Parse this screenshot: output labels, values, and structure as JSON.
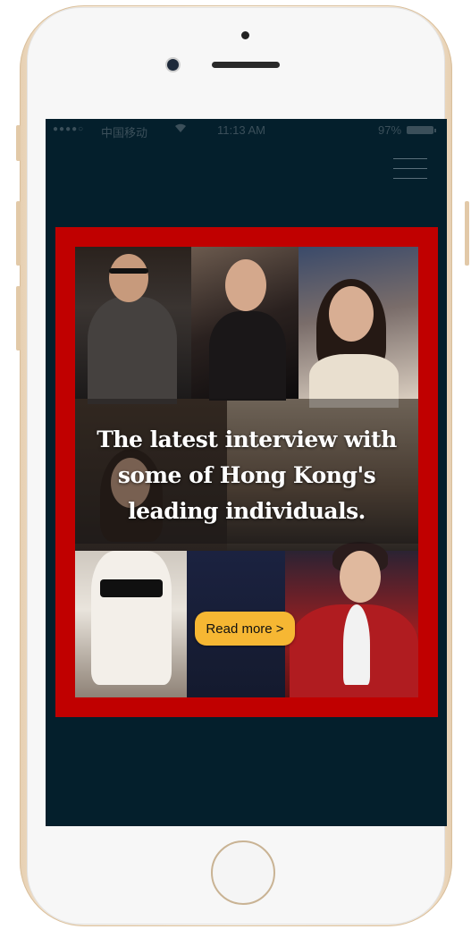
{
  "status_bar": {
    "signal": "●●●●○",
    "carrier": "中国移动",
    "wifi_icon": "wifi-icon",
    "time": "11:13 AM",
    "battery_percent": "97%"
  },
  "header": {
    "menu_icon": "hamburger-menu-icon"
  },
  "banner": {
    "headline": "The latest interview with some of Hong Kong's leading individuals.",
    "button_label": "Read more >",
    "border_color": "#c00000",
    "button_color": "#f6b733"
  },
  "screen": {
    "background_color": "#041f2c"
  }
}
